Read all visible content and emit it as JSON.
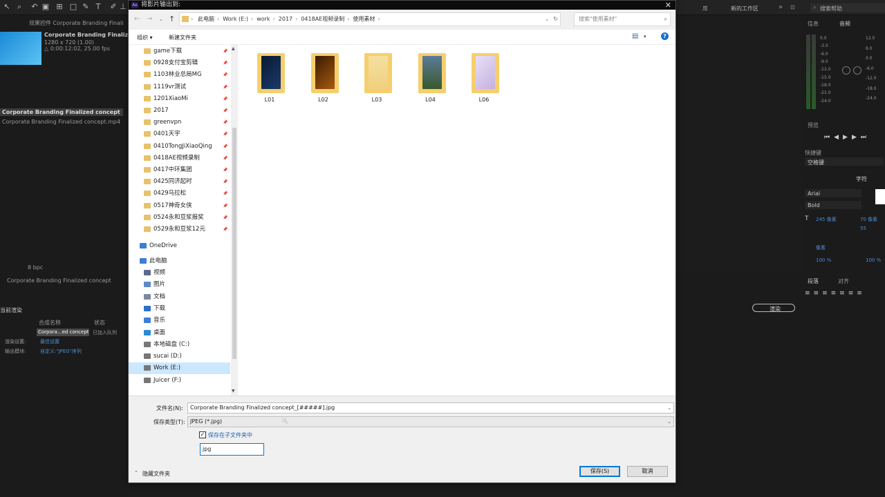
{
  "dialog": {
    "title": "将影片输出到:",
    "close": "✕",
    "breadcrumb": [
      "此电脑",
      "Work (E:)",
      "work",
      "2017",
      "0418AE视频录制",
      "使用素材"
    ],
    "search_placeholder": "搜索\"使用素材\"",
    "organize": "组织 ▾",
    "new_folder": "新建文件夹",
    "help": "?",
    "nav_folders": [
      "game下载",
      "0928支付宝剪辑",
      "1103林业总局MG",
      "1119vr测试",
      "1201XiaoMi",
      "2017",
      "greenvpn",
      "0401天宇",
      "0410TongJiXiaoQing",
      "0418AE视频录制",
      "0417中环集团",
      "0425同济起时",
      "0429马拉松",
      "0517神奇女侠",
      "0524永和豆浆报奖",
      "0529永和豆浆12元"
    ],
    "onedrive": "OneDrive",
    "thispc": "此电脑",
    "pc_items": [
      "视频",
      "图片",
      "文档",
      "下载",
      "音乐",
      "桌面",
      "本地磁盘 (C:)",
      "sucai (D:)",
      "Work (E:)",
      "Juicer (F:)"
    ],
    "files": [
      {
        "name": "L01"
      },
      {
        "name": "L02"
      },
      {
        "name": "L03"
      },
      {
        "name": "L04"
      },
      {
        "name": "L06"
      }
    ],
    "filename_label": "文件名(N):",
    "filename_value": "Corporate Branding  Finalized concept_[#####].jpg",
    "filetype_label": "保存类型(T):",
    "filetype_value": "JPEG (*.jpg)",
    "subfolder_checkbox": "保存在子文件夹中",
    "subfolder_name": "jpg",
    "hide_folders": "隐藏文件夹",
    "save": "保存(S)",
    "cancel": "取消"
  },
  "ae": {
    "effects_tab": "效果控件 Corporate Branding  Finali",
    "comp_name": "Corporate Branding  Finalized c",
    "comp_size": "1280 x 720 (1.00)",
    "comp_dur": "△ 0:00:12:02, 25.00 fps",
    "project_item1": "Corporate Branding  Finalized concept",
    "project_item2": "Corporate Branding  Finalized concept.mp4",
    "bpc": "8 bpc",
    "timeline_tab": "Corporate Branding  Finalized concept",
    "render_queue": "当前渲染",
    "rq_col_name": "合成名称",
    "rq_col_status": "状态",
    "rq_item": "Corpora...ed concept",
    "rq_status": "已加入队列",
    "rq_render_settings_label": "渲染设置:",
    "rq_render_settings": "最佳设置",
    "rq_output_label": "输出模块:",
    "rq_output": "自定义:\"JPEG\"序列",
    "render_btn": "渲染",
    "workspace": "新的工作区",
    "lib": "库",
    "search_help": "搜索帮助",
    "info": "信息",
    "audio": "音频",
    "preview": "预览",
    "shortcut": "快捷键",
    "spacebar": "空格键",
    "paragraph_tab": "段落",
    "align_tab": "对齐",
    "char_tab": "字符",
    "font": "Arial",
    "style": "Bold",
    "size": "245 像素",
    "lead": "70 像素",
    "tracking": "55",
    "scale_v": "100 %",
    "scale_h": "100 %",
    "px": "像素",
    "db_labels": [
      "0.0",
      "-3.0",
      "-6.0",
      "-9.0",
      "-12.0",
      "-15.0",
      "-18.0",
      "-21.0",
      "-24.0"
    ],
    "db_right": [
      "12.0",
      "6.0",
      "0.0",
      "-6.0",
      "-12.0",
      "-18.0",
      "-24.0"
    ]
  }
}
